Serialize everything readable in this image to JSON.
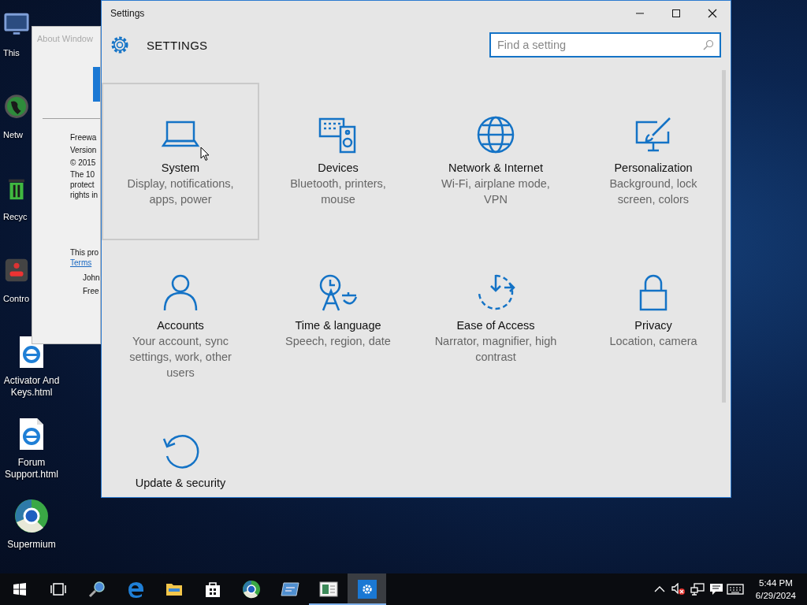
{
  "desktop_icons": [
    {
      "label": "This",
      "kind": "pc",
      "covered": true
    },
    {
      "label": "Netw",
      "kind": "network",
      "covered": true
    },
    {
      "label": "Recyc",
      "kind": "recycle",
      "covered": true
    },
    {
      "label": "Contro",
      "kind": "control",
      "covered": true
    },
    {
      "label": "Activator And Keys.html",
      "kind": "html",
      "covered": false
    },
    {
      "label": "Forum Support.html",
      "kind": "html",
      "covered": false
    },
    {
      "label": "Supermium",
      "kind": "browser",
      "covered": false
    }
  ],
  "about_window": {
    "title": "About Window",
    "lines": [
      "Freewa",
      "Version",
      "© 2015",
      "The 10",
      "protect",
      "rights in"
    ],
    "note": "This pro",
    "link": "Terms",
    "signature": [
      "John",
      "Free"
    ]
  },
  "settings_window": {
    "title": "Settings",
    "heading": "SETTINGS",
    "search": {
      "placeholder": "Find a setting"
    },
    "categories": [
      {
        "name": "System",
        "description": "Display, notifications, apps, power",
        "kind": "system",
        "hovered": true
      },
      {
        "name": "Devices",
        "description": "Bluetooth, printers, mouse",
        "kind": "devices",
        "hovered": false
      },
      {
        "name": "Network & Internet",
        "description": "Wi-Fi, airplane mode, VPN",
        "kind": "network",
        "hovered": false
      },
      {
        "name": "Personalization",
        "description": "Background, lock screen, colors",
        "kind": "personalization",
        "hovered": false
      },
      {
        "name": "Accounts",
        "description": "Your account, sync settings, work, other users",
        "kind": "accounts",
        "hovered": false
      },
      {
        "name": "Time & language",
        "description": "Speech, region, date",
        "kind": "time",
        "hovered": false
      },
      {
        "name": "Ease of Access",
        "description": "Narrator, magnifier, high contrast",
        "kind": "ease",
        "hovered": false
      },
      {
        "name": "Privacy",
        "description": "Location, camera",
        "kind": "privacy",
        "hovered": false
      },
      {
        "name": "Update & security",
        "kind": "update",
        "hovered": false
      }
    ]
  },
  "taskbar": {
    "apps": [
      {
        "kind": "start",
        "running": false,
        "active": false
      },
      {
        "kind": "taskview",
        "running": false,
        "active": false
      },
      {
        "kind": "search",
        "running": false,
        "active": false
      },
      {
        "kind": "edge",
        "running": false,
        "active": false
      },
      {
        "kind": "explorer",
        "running": false,
        "active": false
      },
      {
        "kind": "store",
        "running": false,
        "active": false
      },
      {
        "kind": "browser",
        "running": false,
        "active": false
      },
      {
        "kind": "card",
        "running": false,
        "active": false
      },
      {
        "kind": "about",
        "running": true,
        "active": false
      },
      {
        "kind": "settings",
        "running": true,
        "active": true
      }
    ],
    "tray": [
      {
        "kind": "chevron"
      },
      {
        "kind": "volume-muted"
      },
      {
        "kind": "network"
      },
      {
        "kind": "notifications"
      },
      {
        "kind": "keyboard"
      }
    ],
    "time": "5:44 PM",
    "date": "6/29/2024"
  }
}
